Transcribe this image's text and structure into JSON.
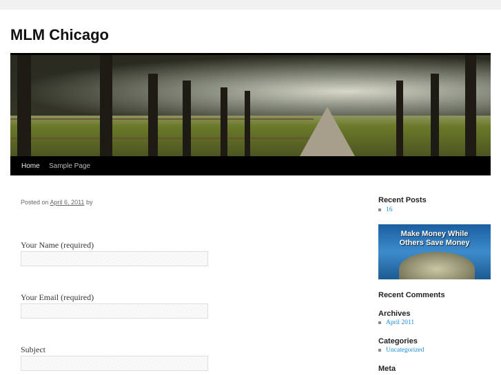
{
  "site": {
    "title": "MLM Chicago"
  },
  "nav": {
    "items": [
      "Home",
      "Sample Page"
    ]
  },
  "post": {
    "posted_on": "Posted on",
    "date": "April 6, 2011",
    "by": "by"
  },
  "form": {
    "name_label": "Your Name (required)",
    "email_label": "Your Email (required)",
    "subject_label": "Subject"
  },
  "sidebar": {
    "recent_posts": {
      "title": "Recent Posts",
      "items": [
        "16"
      ]
    },
    "ad": {
      "text_line1": "Make Money While",
      "text_line2": "Others Save Money"
    },
    "recent_comments": {
      "title": "Recent Comments"
    },
    "archives": {
      "title": "Archives",
      "items": [
        "April 2011"
      ]
    },
    "categories": {
      "title": "Categories",
      "items": [
        "Uncategorized"
      ]
    },
    "meta": {
      "title": "Meta"
    }
  },
  "colors": {
    "link": "#1b8be0",
    "nav_bg": "#000000"
  }
}
